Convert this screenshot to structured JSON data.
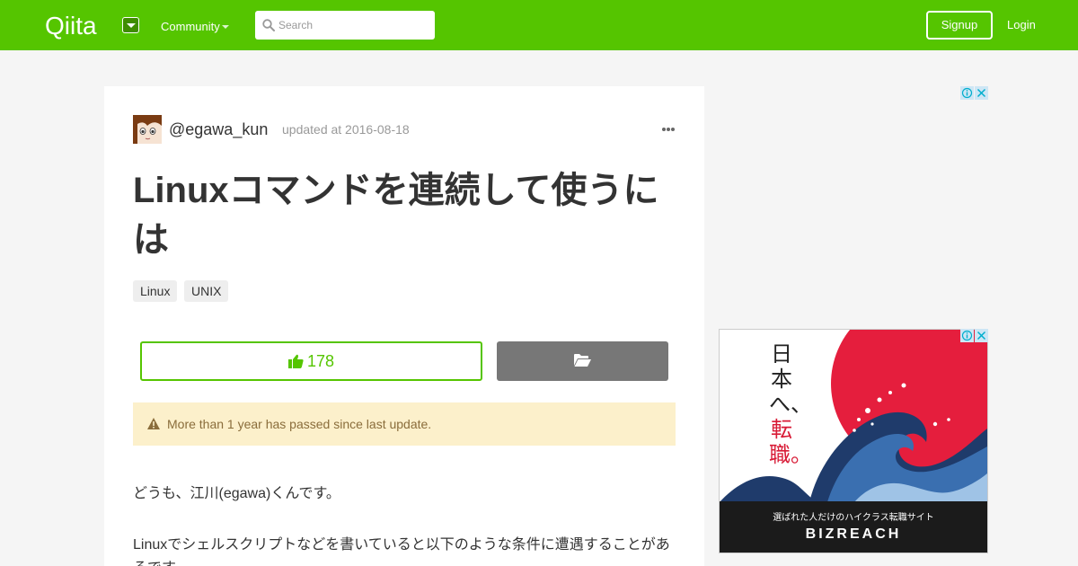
{
  "header": {
    "logo_text": "Qiita",
    "community_label": "Community",
    "search_placeholder": "Search",
    "signup_label": "Signup",
    "login_label": "Login"
  },
  "article": {
    "author": "@egawa_kun",
    "updated": "updated at 2016-08-18",
    "title": "Linuxコマンドを連続して使うには",
    "tags": [
      "Linux",
      "UNIX"
    ],
    "likes": "178",
    "alert": "More than 1 year has passed since last update.",
    "paragraph1": "どうも、江川(egawa)くんです。",
    "paragraph2": "Linuxでシェルスクリプトなどを書いていると以下のような条件に遭遇することがあるです。"
  },
  "ad": {
    "headline_black": "日本へ、",
    "headline_red": "転職。",
    "subline": "選ばれた人だけのハイクラス転職サイト",
    "brand": "BIZREACH"
  },
  "colors": {
    "brand_green": "#55c500",
    "alert_bg": "#fcf0cb",
    "stock_button": "#777777",
    "ad_red": "#d81b36"
  },
  "icons": [
    "qiita-logo",
    "dropdown-caret-icon",
    "search-icon",
    "ellipsis-icon",
    "thumbs-up-icon",
    "folder-open-icon",
    "warning-icon",
    "ad-info-icon",
    "ad-close-icon"
  ]
}
